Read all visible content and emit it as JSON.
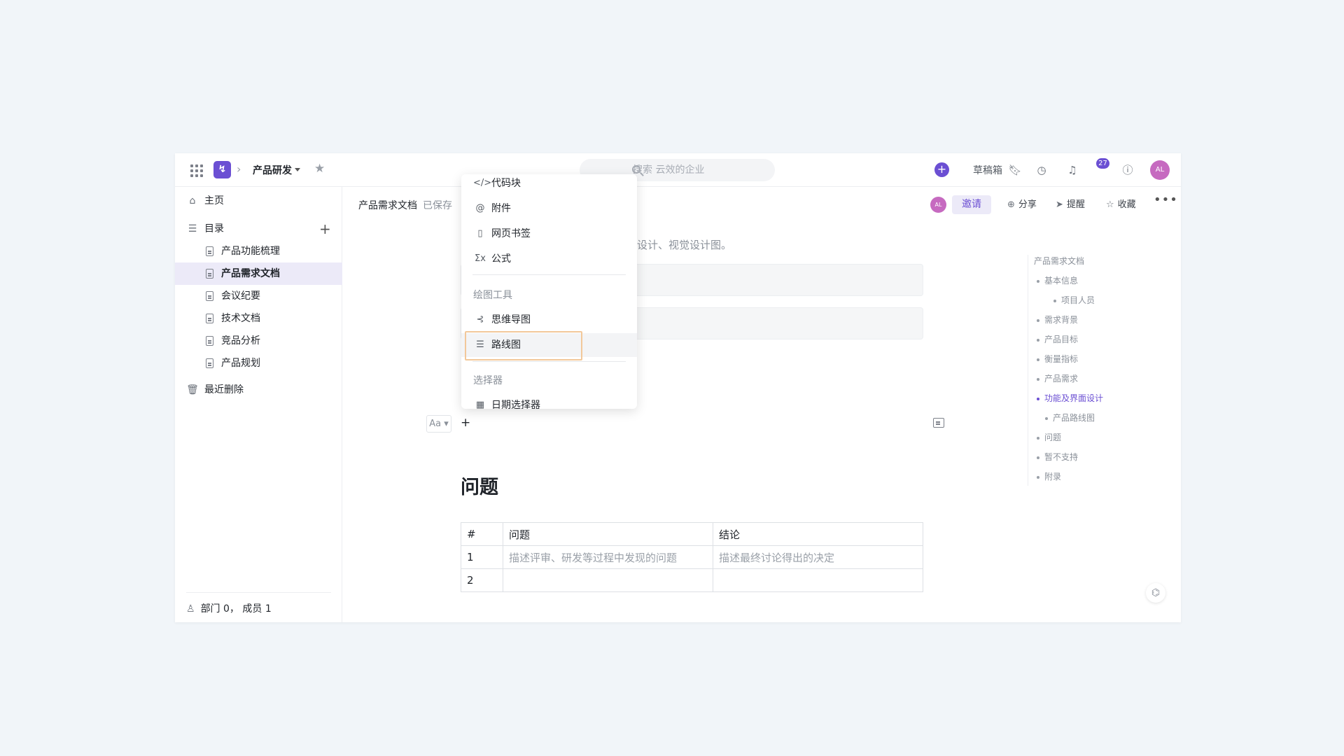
{
  "topbar": {
    "breadcrumb": "产品研发",
    "search_placeholder": "搜索 云效的企业",
    "drafts_label": "草稿箱",
    "notification_count": "27",
    "user_initials": "AL"
  },
  "sidebar": {
    "home": "主页",
    "catalog": "目录",
    "docs": [
      "产品功能梳理",
      "产品需求文档",
      "会议纪要",
      "技术文档",
      "竞品分析",
      "产品规划"
    ],
    "active_doc_index": 1,
    "recent_deleted": "最近删除",
    "footer": "部门 0， 成员 1"
  },
  "doc_header": {
    "title": "产品需求文档",
    "saved_status": "已保存",
    "avatar_initials": "AL",
    "invite": "邀请",
    "share": "分享",
    "remind": "提醒",
    "favorite": "收藏"
  },
  "editor": {
    "placeholder_line": "设计、视觉设计图。",
    "font_button": "Aa",
    "section_title": "问题",
    "table": {
      "headers": [
        "#",
        "问题",
        "结论"
      ],
      "rows": [
        [
          "1",
          "描述评审、研发等过程中发现的问题",
          "描述最终讨论得出的决定"
        ],
        [
          "2",
          "",
          ""
        ]
      ]
    }
  },
  "menu": {
    "items_top": [
      {
        "icon": "code-icon",
        "label": "代码块"
      },
      {
        "icon": "attachment-icon",
        "label": "附件"
      },
      {
        "icon": "bookmark-icon",
        "label": "网页书签"
      },
      {
        "icon": "formula-icon",
        "label": "公式"
      }
    ],
    "group_draw": "绘图工具",
    "items_draw": [
      {
        "icon": "mindmap-icon",
        "label": "思维导图"
      },
      {
        "icon": "roadmap-icon",
        "label": "路线图"
      }
    ],
    "group_picker": "选择器",
    "items_picker": [
      {
        "icon": "calendar-icon",
        "label": "日期选择器"
      }
    ]
  },
  "toc": {
    "title": "产品需求文档",
    "items": [
      {
        "label": "基本信息",
        "level": 1
      },
      {
        "label": "项目人员",
        "level": 3
      },
      {
        "label": "需求背景",
        "level": 1
      },
      {
        "label": "产品目标",
        "level": 1
      },
      {
        "label": "衡量指标",
        "level": 1
      },
      {
        "label": "产品需求",
        "level": 1
      },
      {
        "label": "功能及界面设计",
        "level": 1,
        "active": true
      },
      {
        "label": "产品路线图",
        "level": 2
      },
      {
        "label": "问题",
        "level": 1
      },
      {
        "label": "暂不支持",
        "level": 1
      },
      {
        "label": "附录",
        "level": 1
      }
    ]
  },
  "colors": {
    "accent": "#6b4fd3",
    "highlight_border": "#f2c89a",
    "avatar": "#c66ac0"
  }
}
